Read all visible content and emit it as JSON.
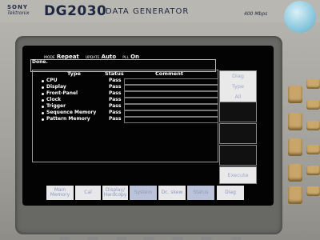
{
  "header": {
    "brand": "SONY",
    "sub_brand": "Tektronix",
    "model": "DG2030",
    "model_sub": "DATA GENERATOR",
    "rate": "400 Mbps"
  },
  "status_bar": {
    "mode_label": "MODE",
    "mode_value": "Repeat",
    "update_label": "UPDATE",
    "update_value": "Auto",
    "pll_label": "PLL",
    "pll_value": "On",
    "message": "Done."
  },
  "table": {
    "headers": [
      "Type",
      "Status",
      "Comment"
    ],
    "rows": [
      {
        "type": "CPU",
        "status": "Pass",
        "comment": ""
      },
      {
        "type": "Display",
        "status": "Pass",
        "comment": ""
      },
      {
        "type": "Front-Panel",
        "status": "Pass",
        "comment": ""
      },
      {
        "type": "Clock",
        "status": "Pass",
        "comment": ""
      },
      {
        "type": "Trigger",
        "status": "Pass",
        "comment": ""
      },
      {
        "type": "Sequence Memory",
        "status": "Pass",
        "comment": ""
      },
      {
        "type": "Pattern Memory",
        "status": "Pass",
        "comment": ""
      }
    ]
  },
  "side_menu": {
    "diag_type_line1": "Diag",
    "diag_type_line2": "Type",
    "diag_type_line3": "All",
    "execute": "Execute"
  },
  "bottom_menu": [
    {
      "line1": "Main",
      "line2": "Memory"
    },
    {
      "line1": "Cal",
      "line2": ""
    },
    {
      "line1": "Display/",
      "line2": "Hardcopy"
    },
    {
      "line1": "System",
      "line2": ""
    },
    {
      "line1": "Dc. skew",
      "line2": ""
    },
    {
      "line1": "Status",
      "line2": ""
    },
    {
      "line1": "Diag",
      "line2": ""
    }
  ]
}
